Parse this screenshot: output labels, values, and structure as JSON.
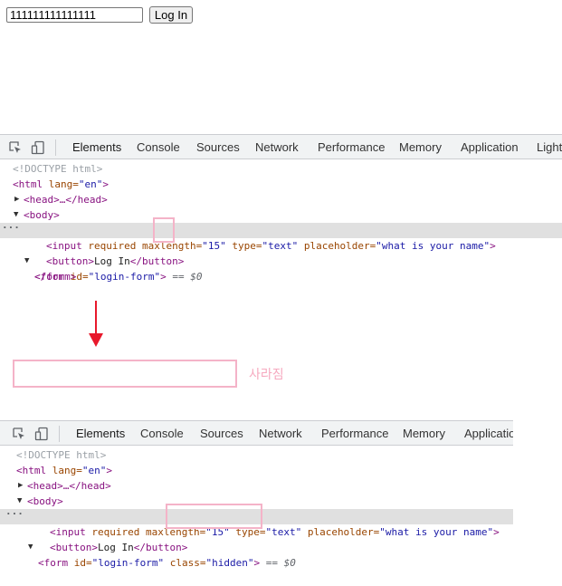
{
  "page": {
    "input_value": "111111111111111",
    "button_label": "Log In"
  },
  "devtools_top": {
    "tabs": [
      "Elements",
      "Console",
      "Sources",
      "Network",
      "Performance",
      "Memory",
      "Application",
      "Light"
    ],
    "lines": {
      "doctype": "<!DOCTYPE html>",
      "html_open": "<html",
      "html_attr_name": " lang=",
      "html_attr_value": "\"en\"",
      "html_close": ">",
      "head": "<head>…</head>",
      "body": "<body>",
      "form_open": "<form",
      "form_attr_name": " id=",
      "form_attr_value": "\"login-form\"",
      "form_close": ">",
      "eq_marker": " == $0",
      "input_open": "<input",
      "input_attr1": " required maxlength=",
      "input_val1": "\"15\"",
      "input_attr2": " type=",
      "input_val2": "\"text\"",
      "input_attr3": " placeholder=",
      "input_val3": "\"what is your name\"",
      "input_close": ">",
      "button_open": "<button>",
      "button_text": "Log In",
      "button_close": "</button>",
      "form_end": "</form>"
    }
  },
  "annotation": {
    "note": "사라짐"
  },
  "devtools_bottom": {
    "tabs": [
      "Elements",
      "Console",
      "Sources",
      "Network",
      "Performance",
      "Memory",
      "Applicatio"
    ],
    "lines": {
      "doctype": "<!DOCTYPE html>",
      "html_open": "<html",
      "html_attr_name": " lang=",
      "html_attr_value": "\"en\"",
      "html_close": ">",
      "head": "<head>…</head>",
      "body": "<body>",
      "form_open": "<form",
      "form_attr_name": " id=",
      "form_attr_value": "\"login-form\"",
      "class_attr_name": "class=",
      "class_attr_value": "\"hidden\"",
      "form_close": ">",
      "eq_marker": " == $0",
      "input_open": "<input",
      "input_attr1": " required maxlength=",
      "input_val1": "\"15\"",
      "input_attr2": " type=",
      "input_val2": "\"text\"",
      "input_attr3": " placeholder=",
      "input_val3": "\"what is your name\"",
      "input_close": ">",
      "button_open": "<button>",
      "button_text": "Log In",
      "button_close": "</button>"
    }
  },
  "colors": {
    "tab_underline": "#1a73e8",
    "highlight_box": "#f4b3c8",
    "arrow": "#e8192c",
    "selected_row": "#e0e0e0"
  },
  "icons": [
    "inspect-icon",
    "device-toggle-icon",
    "expand-triangle-icon",
    "collapse-triangle-icon",
    "more-dots-icon",
    "down-arrow-icon"
  ]
}
